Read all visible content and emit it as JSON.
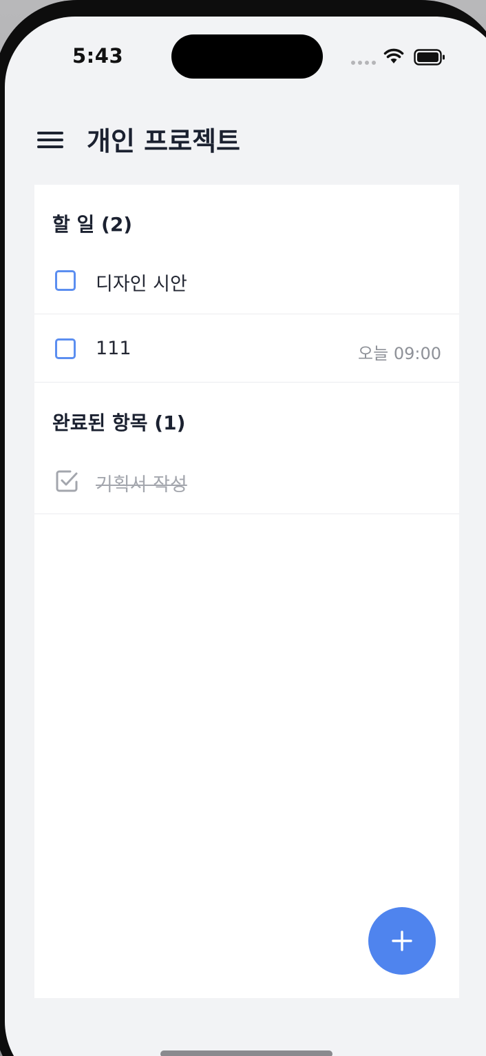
{
  "status_bar": {
    "time": "5:43"
  },
  "header": {
    "title": "개인 프로젝트",
    "menu_icon": "hamburger-menu-icon"
  },
  "todo_section": {
    "title": "할 일 (2)",
    "items": [
      {
        "label": "디자인 시안",
        "due": ""
      },
      {
        "label": "111",
        "due": "오늘 09:00"
      }
    ]
  },
  "done_section": {
    "title": "완료된 항목 (1)",
    "items": [
      {
        "label": "기획서 작성"
      }
    ]
  },
  "fab": {
    "icon": "plus-icon"
  },
  "colors": {
    "accent": "#4f84ee",
    "checkbox_border": "#5b8ef0",
    "title_text": "#1b2130",
    "muted_text": "#8e9198",
    "background": "#f2f3f5"
  }
}
